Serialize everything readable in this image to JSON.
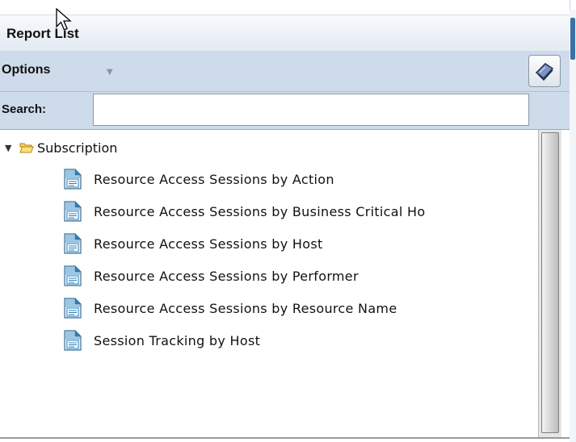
{
  "panel": {
    "title": "Report List",
    "options_label": "Options",
    "search_label": "Search:",
    "search_value": "",
    "search_placeholder": ""
  },
  "tree": {
    "folder": {
      "label": "Subscription",
      "expanded": true
    },
    "reports": [
      {
        "label": "Resource Access Sessions by Action"
      },
      {
        "label": "Resource Access Sessions by Business Critical Ho"
      },
      {
        "label": "Resource Access Sessions by Host"
      },
      {
        "label": "Resource Access Sessions by Performer"
      },
      {
        "label": "Resource Access Sessions by Resource Name"
      },
      {
        "label": "Session Tracking by Host"
      }
    ]
  },
  "colors": {
    "toolbar_bg": "#cddbea",
    "folder_icon": "#f2b500",
    "report_icon": "#2e7fb8"
  },
  "icons": {
    "toggle": "triangle-down-icon",
    "folder": "folder-open-icon",
    "report": "report-document-icon",
    "book": "book-icon",
    "options_caret": "caret-down-icon"
  }
}
